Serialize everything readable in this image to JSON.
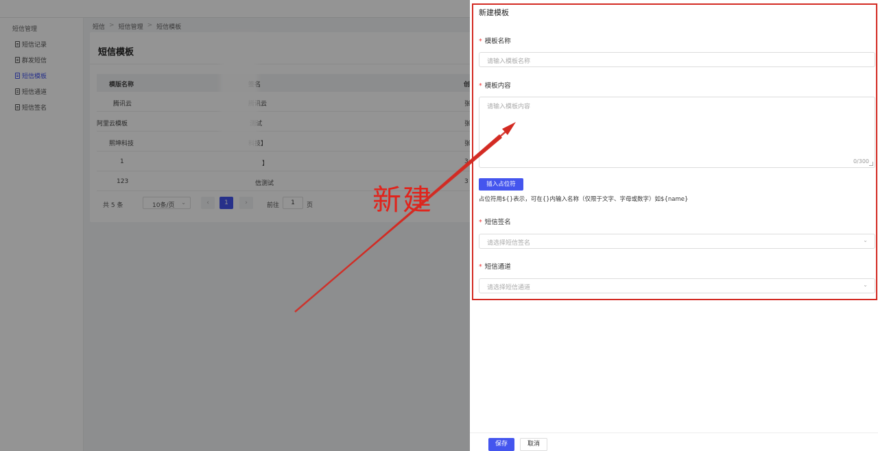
{
  "sidebar": {
    "group": "短信管理",
    "items": [
      {
        "label": "短信记录"
      },
      {
        "label": "群发短信"
      },
      {
        "label": "短信模板"
      },
      {
        "label": "短信通道"
      },
      {
        "label": "短信签名"
      }
    ]
  },
  "breadcrumb": [
    "短信",
    "短信管理",
    "短信模板"
  ],
  "page": {
    "title": "短信模板",
    "columns": [
      "模版名称",
      "签名",
      "创"
    ],
    "rows": [
      [
        "腾讯云",
        "腾讯云",
        "张"
      ],
      [
        "阿里云模板",
        "测试",
        "张"
      ],
      [
        "熙坤科技",
        "科技】",
        "张"
      ],
      [
        "1",
        "】",
        "3"
      ],
      [
        "123",
        "信测试",
        "3"
      ]
    ],
    "pagination": {
      "total": "共 5 条",
      "page_size": "10条/页",
      "current": "1",
      "goto_label": "前往",
      "goto_value": "1",
      "page_suffix": "页"
    }
  },
  "drawer": {
    "title": "新建模板",
    "name_label": "模板名称",
    "name_placeholder": "请输入模板名称",
    "content_label": "模板内容",
    "content_placeholder": "请输入模板内容",
    "content_counter": "0/300",
    "insert_button": "插入占位符",
    "hint": "占位符用${}表示，可在{}内输入名称（仅限于文字、字母或数字）如${name}",
    "sign_label": "短信签名",
    "sign_placeholder": "请选择短信签名",
    "channel_label": "短信通道",
    "channel_placeholder": "请选择短信通道",
    "save_button": "保存",
    "cancel_button": "取消"
  },
  "annotation": {
    "text": "新建",
    "color": "#e0241c"
  },
  "colors": {
    "primary": "#4455ee",
    "annotation": "#d32a22",
    "required": "#e33333"
  }
}
